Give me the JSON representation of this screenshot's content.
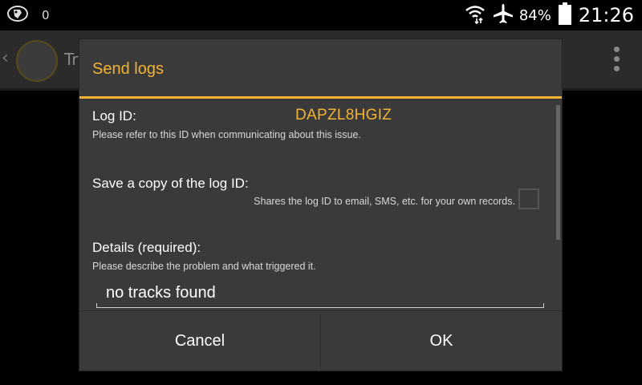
{
  "status_bar": {
    "app_icon": "app-logo-icon",
    "notification_count": "0",
    "wifi_icon": "wifi-icon",
    "airplane_icon": "airplane-mode-icon",
    "battery_percent": "84%",
    "battery_icon": "battery-icon",
    "clock": "21:26"
  },
  "background_app": {
    "title": "Tr"
  },
  "dialog": {
    "title": "Send logs",
    "log_id_label": "Log ID:",
    "log_id_value": "DAPZL8HGIZ",
    "log_id_hint": "Please refer to this ID when communicating about this issue.",
    "save_copy_label": "Save a copy of the log ID:",
    "save_copy_hint": "Shares the log ID to email, SMS, etc. for your own records.",
    "save_copy_checked": false,
    "details_label": "Details (required):",
    "details_hint": "Please describe the problem and what triggered it.",
    "details_value": "no tracks found",
    "cancel_label": "Cancel",
    "ok_label": "OK"
  },
  "colors": {
    "accent": "#f2b233",
    "dialog_bg": "#3a3a3a",
    "background": "#000000"
  }
}
